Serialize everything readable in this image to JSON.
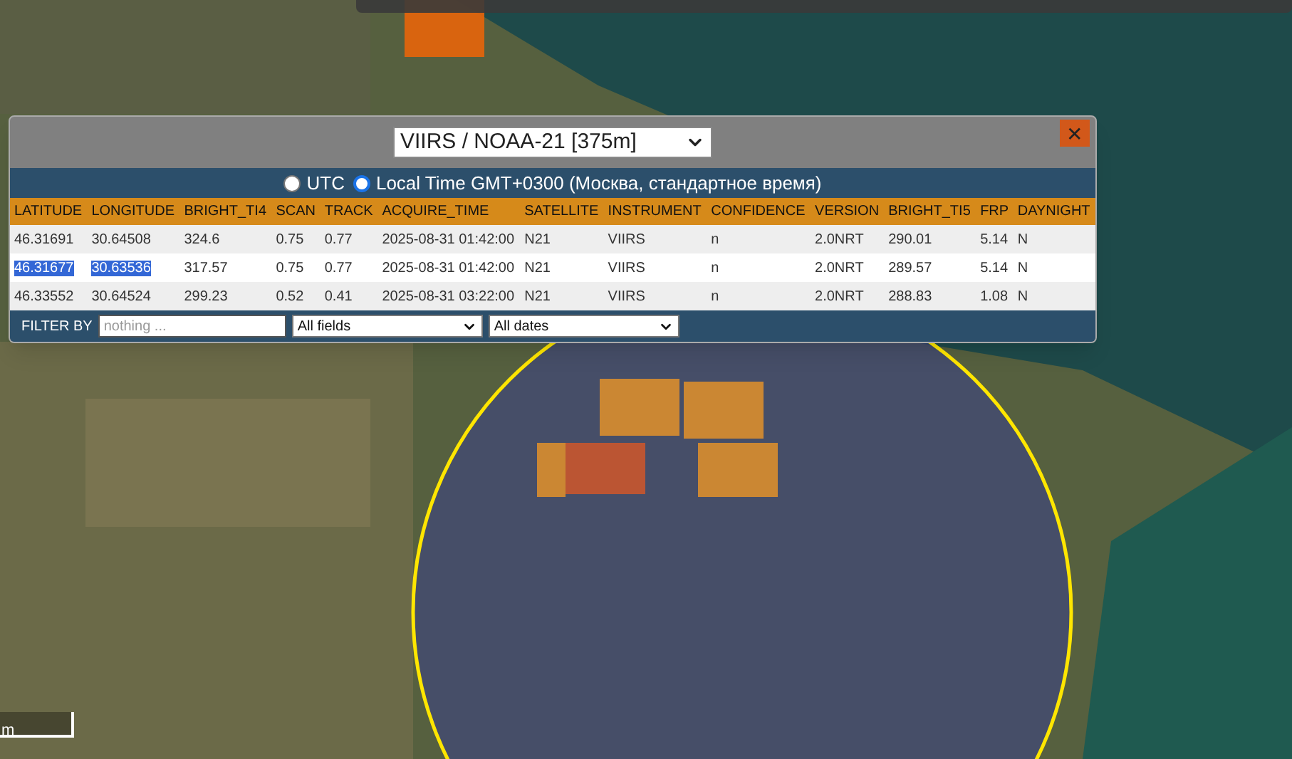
{
  "popup": {
    "product_select": {
      "value": "VIIRS / NOAA-21 [375m]"
    },
    "close_label": "✕",
    "time_options": [
      {
        "label": "UTC",
        "selected": false
      },
      {
        "label": "Local Time GMT+0300 (Москва, стандартное время)",
        "selected": true
      }
    ],
    "table": {
      "columns": [
        "LATITUDE",
        "LONGITUDE",
        "BRIGHT_TI4",
        "SCAN",
        "TRACK",
        "ACQUIRE_TIME",
        "SATELLITE",
        "INSTRUMENT",
        "CONFIDENCE",
        "VERSION",
        "BRIGHT_TI5",
        "FRP",
        "DAYNIGHT"
      ],
      "rows": [
        {
          "cells": [
            {
              "text": "46.31691",
              "highlighted": false
            },
            {
              "text": "30.64508",
              "highlighted": false
            },
            {
              "text": "324.6",
              "highlighted": false
            },
            {
              "text": "0.75",
              "highlighted": false
            },
            {
              "text": "0.77",
              "highlighted": false
            },
            {
              "text": "2025-08-31 01:42:00",
              "highlighted": false
            },
            {
              "text": "N21",
              "highlighted": false
            },
            {
              "text": "VIIRS",
              "highlighted": false
            },
            {
              "text": "n",
              "highlighted": false
            },
            {
              "text": "2.0NRT",
              "highlighted": false
            },
            {
              "text": "290.01",
              "highlighted": false
            },
            {
              "text": "5.14",
              "highlighted": false
            },
            {
              "text": "N",
              "highlighted": false
            }
          ]
        },
        {
          "cells": [
            {
              "text": "46.31677",
              "highlighted": true
            },
            {
              "text": "30.63536",
              "highlighted": true
            },
            {
              "text": "317.57",
              "highlighted": false
            },
            {
              "text": "0.75",
              "highlighted": false
            },
            {
              "text": "0.77",
              "highlighted": false
            },
            {
              "text": "2025-08-31 01:42:00",
              "highlighted": false
            },
            {
              "text": "N21",
              "highlighted": false
            },
            {
              "text": "VIIRS",
              "highlighted": false
            },
            {
              "text": "n",
              "highlighted": false
            },
            {
              "text": "2.0NRT",
              "highlighted": false
            },
            {
              "text": "289.57",
              "highlighted": false
            },
            {
              "text": "5.14",
              "highlighted": false
            },
            {
              "text": "N",
              "highlighted": false
            }
          ]
        },
        {
          "cells": [
            {
              "text": "46.33552",
              "highlighted": false
            },
            {
              "text": "30.64524",
              "highlighted": false
            },
            {
              "text": "299.23",
              "highlighted": false
            },
            {
              "text": "0.52",
              "highlighted": false
            },
            {
              "text": "0.41",
              "highlighted": false
            },
            {
              "text": "2025-08-31 03:22:00",
              "highlighted": false
            },
            {
              "text": "N21",
              "highlighted": false
            },
            {
              "text": "VIIRS",
              "highlighted": false
            },
            {
              "text": "n",
              "highlighted": false
            },
            {
              "text": "2.0NRT",
              "highlighted": false
            },
            {
              "text": "288.83",
              "highlighted": false
            },
            {
              "text": "1.08",
              "highlighted": false
            },
            {
              "text": "N",
              "highlighted": false
            }
          ]
        }
      ]
    },
    "filter": {
      "label": "FILTER BY",
      "placeholder": "nothing ...",
      "field_select": "All fields",
      "date_select": "All dates"
    }
  },
  "scale_bar": {
    "label": "m"
  }
}
